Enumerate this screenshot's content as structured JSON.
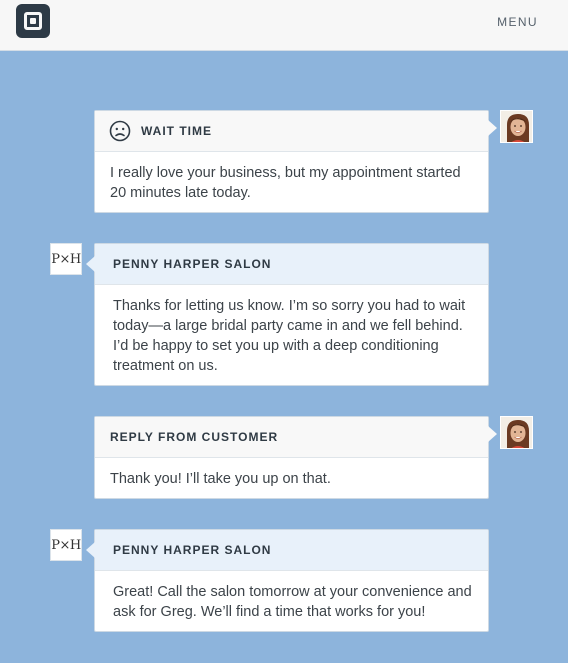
{
  "header": {
    "menu_label": "MENU",
    "logo_icon": "square-logo-icon"
  },
  "thread": [
    {
      "kind": "customer",
      "title": "WAIT TIME",
      "icon": "sad-face-icon",
      "message": "I really love your business, but my appointment started 20 minutes late today."
    },
    {
      "kind": "salon",
      "title": "PENNY HARPER SALON",
      "monogram": "P×H",
      "message": "Thanks for letting us know. I’m so sorry you had to wait today—a large bridal party came in and we fell behind. I’d be happy to set you up with a deep conditioning treatment on us."
    },
    {
      "kind": "customer",
      "title": "REPLY FROM CUSTOMER",
      "message": "Thank you! I’ll take you up on that."
    },
    {
      "kind": "salon",
      "title": "PENNY HARPER SALON",
      "monogram": "P×H",
      "message": "Great! Call the salon tomorrow at your convenience and ask for Greg. We’ll find a time that works for you!"
    }
  ],
  "colors": {
    "background": "#8db4dc",
    "topbar": "#f7f7f7",
    "salon_header": "#e8f1fa",
    "logo": "#2d3a46"
  }
}
